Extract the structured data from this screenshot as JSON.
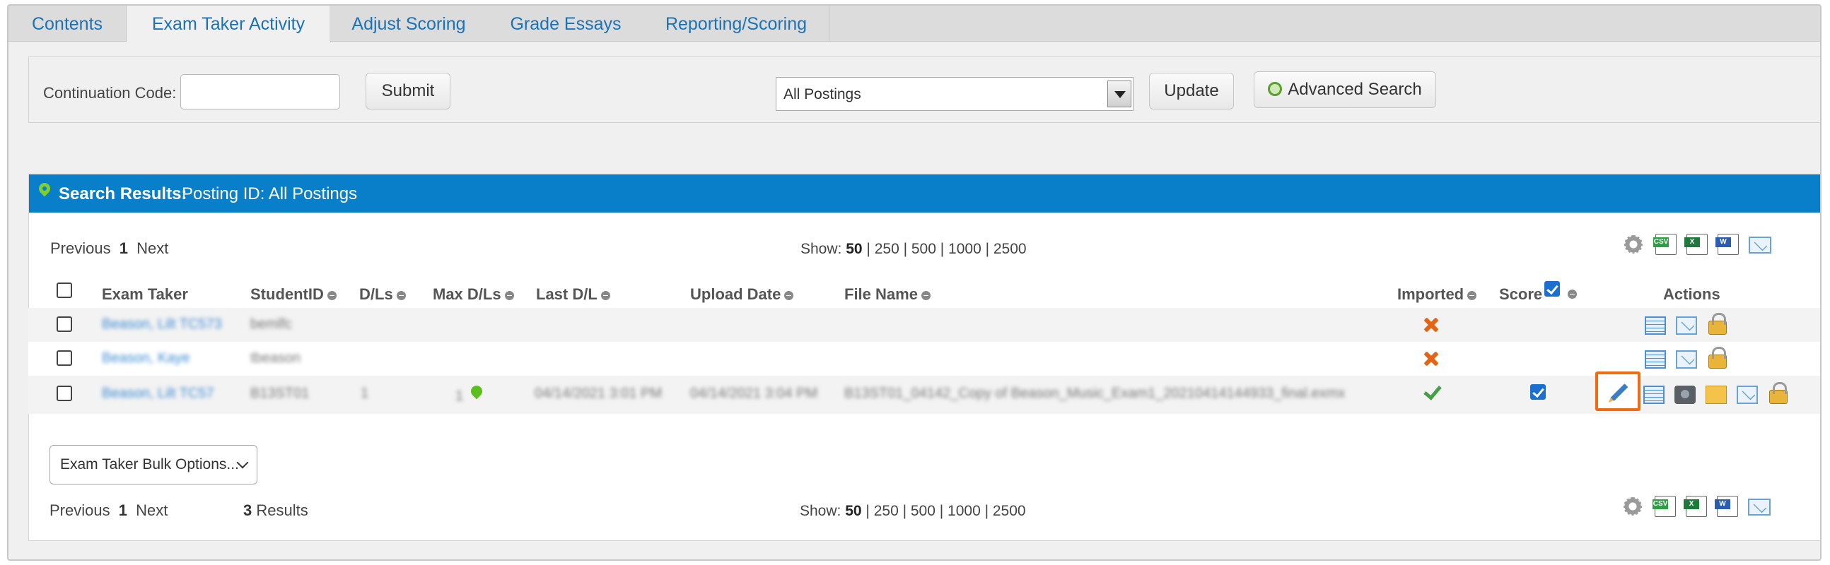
{
  "tabs": [
    {
      "label": "Contents",
      "active": false
    },
    {
      "label": "Exam Taker Activity",
      "active": true
    },
    {
      "label": "Adjust Scoring",
      "active": false
    },
    {
      "label": "Grade Essays",
      "active": false
    },
    {
      "label": "Reporting/Scoring",
      "active": false
    }
  ],
  "filter": {
    "continuation_label": "Continuation Code:",
    "continuation_value": "",
    "submit_label": "Submit",
    "posting_select": "All Postings",
    "update_label": "Update",
    "advanced_search_label": "Advanced Search"
  },
  "results": {
    "title": "Search Results:",
    "posting": "Posting ID: All Postings",
    "pager_top": {
      "prev": "Previous",
      "page": "1",
      "next": "Next"
    },
    "pager_bottom": {
      "prev": "Previous",
      "page": "1",
      "next": "Next"
    },
    "show_label": "Show:",
    "show_options": {
      "current": "50",
      "rest": "| 250 | 500 | 1000 | 2500"
    },
    "results_count": "3",
    "results_word": "Results",
    "bulk_options": "Exam Taker Bulk Options..."
  },
  "columns": {
    "exam_taker": "Exam Taker",
    "student_id": "StudentID",
    "dls": "D/Ls",
    "max_dls": "Max D/Ls",
    "last_dl": "Last D/L",
    "upload_date": "Upload Date",
    "file_name": "File Name",
    "imported": "Imported",
    "score": "Score",
    "actions": "Actions"
  },
  "rows": [
    {
      "name": "Beason, Lilt TC573",
      "student_id": "bemlfc",
      "dls": "",
      "max_dls": "",
      "last_dl": "",
      "upload_date": "",
      "file_name": "",
      "imported": "no",
      "score": false
    },
    {
      "name": "Beason, Kaye",
      "student_id": "tbeason",
      "dls": "",
      "max_dls": "",
      "last_dl": "",
      "upload_date": "",
      "file_name": "",
      "imported": "no",
      "score": false
    },
    {
      "name": "Beason, Lilt TC57",
      "student_id": "B13ST01",
      "dls": "1",
      "max_dls": "1",
      "last_dl": "04/14/2021 3:01 PM",
      "upload_date": "04/14/2021 3:04 PM",
      "file_name": "B13ST01_04142_Copy of Beason_Music_Exam1_20210414144933_final.exmx",
      "imported": "yes",
      "score": true
    }
  ],
  "icons": {
    "gear": "gear-icon",
    "csv": "csv-export-icon",
    "excel": "excel-export-icon",
    "word": "word-export-icon",
    "mail": "mail-icon"
  },
  "colors": {
    "header_blue": "#0a7fc9",
    "tab_text": "#1a73b8",
    "highlight": "#ef6c13"
  }
}
